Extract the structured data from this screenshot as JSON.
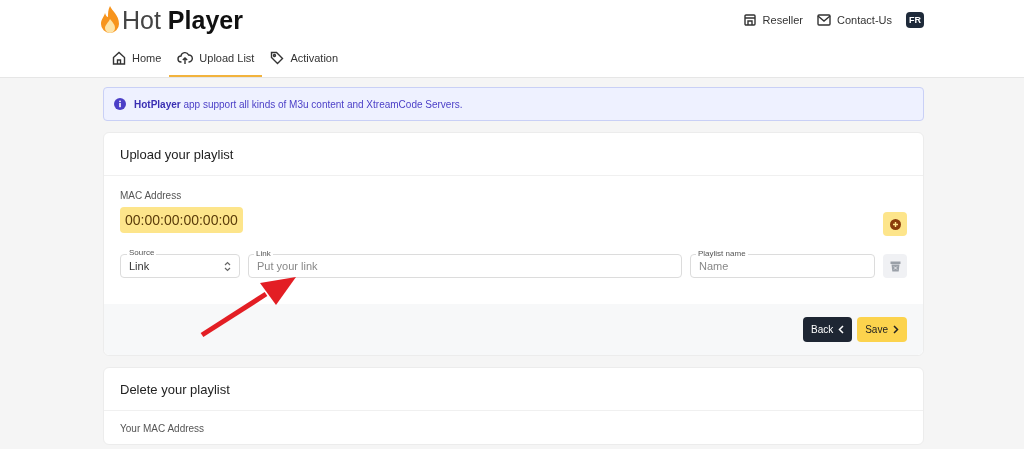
{
  "logo": {
    "text": "Hot **Player**"
  },
  "top_links": [
    {
      "label": "Reseller",
      "kind": "store"
    },
    {
      "label": "Contact-Us",
      "kind": "mail"
    }
  ],
  "language": "FR",
  "tabs": [
    {
      "label": "Home",
      "kind": "home",
      "selected": false
    },
    {
      "label": "Upload List",
      "kind": "upload",
      "selected": true
    },
    {
      "label": "Activation",
      "kind": "tag",
      "selected": false
    }
  ],
  "alert": "**HotPlayer** app support all kinds of M3u content and XtreamCode Servers.",
  "upload_card": {
    "title": "Upload your playlist",
    "mac_label": "MAC Address",
    "mac_value": "00:00:00:00:00:00",
    "source": {
      "label": "Source",
      "value": "Link"
    },
    "link": {
      "label": "Link",
      "placeholder": "Put your link"
    },
    "playlist_name": {
      "label": "Playlist name",
      "placeholder": "Name"
    },
    "buttons": [
      {
        "label": "Back",
        "kind": "back"
      },
      {
        "label": "Save",
        "kind": "save"
      }
    ]
  },
  "delete_card": {
    "title": "Delete your playlist",
    "mac_label": "Your MAC Address"
  }
}
